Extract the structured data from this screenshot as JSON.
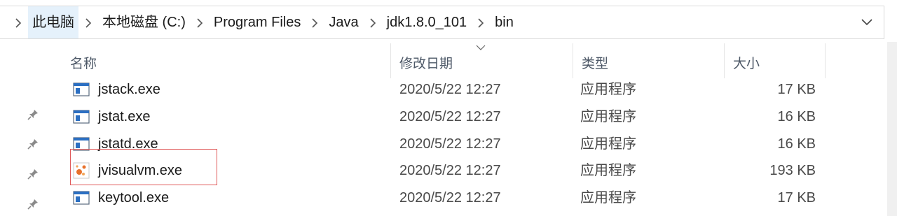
{
  "breadcrumb": [
    "此电脑",
    "本地磁盘 (C:)",
    "Program Files",
    "Java",
    "jdk1.8.0_101",
    "bin"
  ],
  "columns": {
    "name": "名称",
    "date": "修改日期",
    "type": "类型",
    "size": "大小"
  },
  "files": [
    {
      "name": "jstack.exe",
      "date": "2020/5/22 12:27",
      "type": "应用程序",
      "size": "17 KB",
      "icon": "exe-icon"
    },
    {
      "name": "jstat.exe",
      "date": "2020/5/22 12:27",
      "type": "应用程序",
      "size": "16 KB",
      "icon": "exe-icon"
    },
    {
      "name": "jstatd.exe",
      "date": "2020/5/22 12:27",
      "type": "应用程序",
      "size": "16 KB",
      "icon": "exe-icon"
    },
    {
      "name": "jvisualvm.exe",
      "date": "2020/5/22 12:27",
      "type": "应用程序",
      "size": "193 KB",
      "icon": "visualvm-icon"
    },
    {
      "name": "keytool.exe",
      "date": "2020/5/22 12:27",
      "type": "应用程序",
      "size": "17 KB",
      "icon": "exe-icon"
    }
  ],
  "colors": {
    "highlight": "#e05a5a",
    "crumb_active_bg": "#e5f1fb",
    "exe_icon_blue": "#2b6fc2"
  }
}
